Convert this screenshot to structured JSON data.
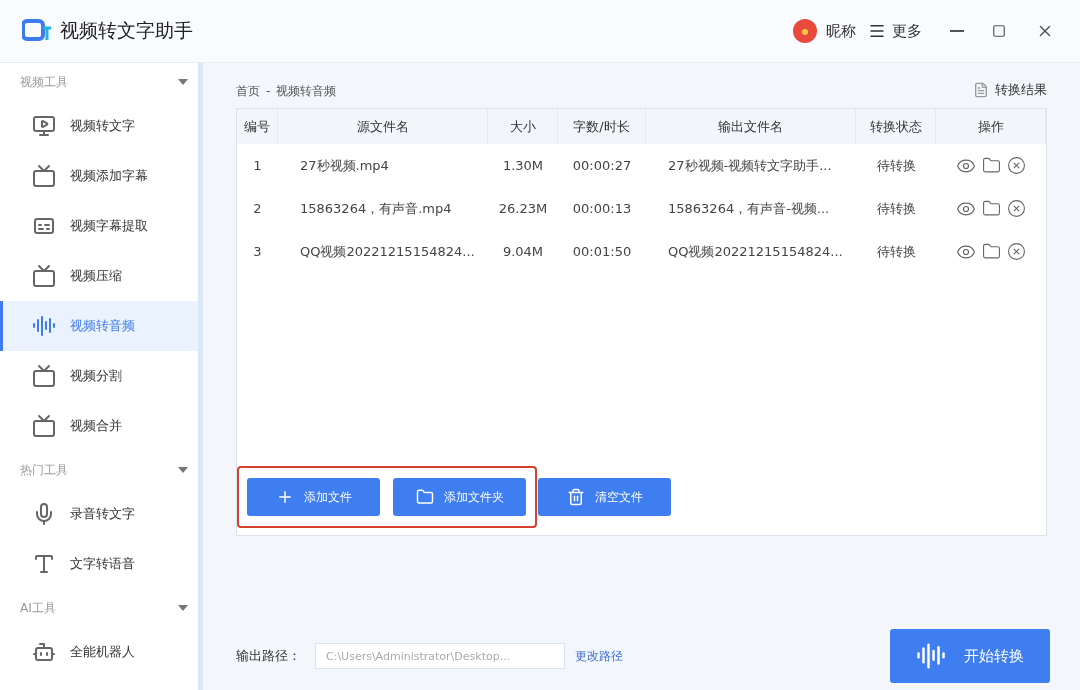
{
  "window": {
    "title": "视频转文字助手",
    "user": "昵称",
    "more": "更多"
  },
  "sidebar": {
    "sections": [
      {
        "title": "视频工具",
        "items": [
          {
            "label": "视频转文字",
            "selected": false
          },
          {
            "label": "视频添加字幕",
            "selected": false
          },
          {
            "label": "视频字幕提取",
            "selected": false
          },
          {
            "label": "视频压缩",
            "selected": false
          },
          {
            "label": "视频转音频",
            "selected": true
          },
          {
            "label": "视频分割",
            "selected": false
          },
          {
            "label": "视频合并",
            "selected": false
          }
        ]
      },
      {
        "title": "热门工具",
        "items": [
          {
            "label": "录音转文字",
            "selected": false
          },
          {
            "label": "文字转语音",
            "selected": false
          }
        ]
      },
      {
        "title": "AI工具",
        "items": [
          {
            "label": "全能机器人",
            "selected": false
          }
        ]
      }
    ]
  },
  "breadcrumb": [
    "首页",
    "-",
    "视频转音频"
  ],
  "results_link": "转换结果",
  "table": {
    "columns": [
      "编号",
      "源文件名",
      "大小",
      "字数/时长",
      "输出文件名",
      "转换状态",
      "操作"
    ],
    "rows": [
      {
        "no": "1",
        "source": "27秒视频.mp4",
        "size": "1.30M",
        "duration": "00:00:27",
        "output": "27秒视频-视频转文字助手...",
        "status": "待转换"
      },
      {
        "no": "2",
        "source": "15863264，有声音.mp4",
        "size": "26.23M",
        "duration": "00:00:13",
        "output": "15863264，有声音-视频...",
        "status": "待转换"
      },
      {
        "no": "3",
        "source": "QQ视频20221215154824...",
        "size": "9.04M",
        "duration": "00:01:50",
        "output": "QQ视频20221215154824...",
        "status": "待转换"
      }
    ]
  },
  "actions": [
    {
      "label": "添加文件",
      "kind": "add"
    },
    {
      "label": "添加文件夹",
      "kind": "folder"
    },
    {
      "label": "清空文件",
      "kind": "clear"
    }
  ],
  "output_path": {
    "label": "输出路径：",
    "value": "C:\\Users\\Administrator\\Desktop...",
    "change": "更改路径"
  },
  "start_button": "开始转换"
}
